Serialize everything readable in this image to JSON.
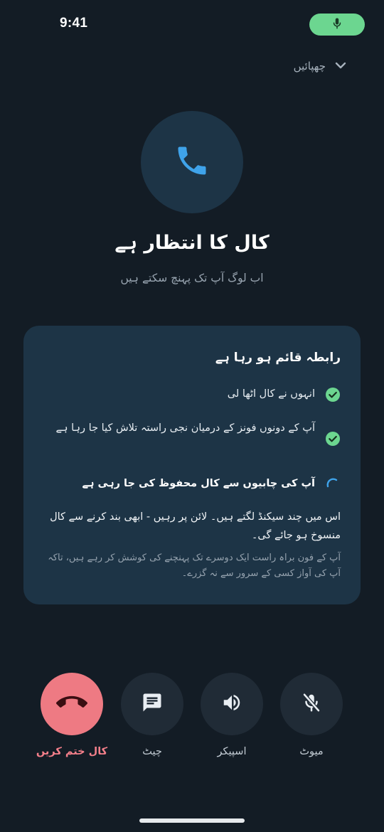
{
  "status_bar": {
    "time": "9:41",
    "mic_icon": "mic-icon"
  },
  "hide_control": {
    "label": "چھپائیں",
    "icon": "chevron-down-icon"
  },
  "call": {
    "icon": "phone-icon",
    "title": "کال کا انتظار ہے",
    "subtitle": "اب لوگ آپ تک پہنچ سکتے ہیں"
  },
  "card": {
    "title": "رابطہ قائم ہو رہا ہے",
    "steps": [
      {
        "label": "انہوں نے کال اٹھا لی",
        "status": "done"
      },
      {
        "label": "آپ کے دونوں فونز کے درمیان نجی راستہ تلاش کیا جا رہا ہے",
        "status": "done"
      },
      {
        "label": "آپ کی چابیوں سے کال محفوظ کی جا رہی ہے",
        "status": "in-progress"
      }
    ],
    "note": "اس میں چند سیکنڈ لگتے ہیں۔ لائن پر رہیں - ابھی بند کرنے سے کال منسوخ ہو جائے گی۔",
    "fine_print": "آپ کے فون براہ راست ایک دوسرے تک پہنچنے کی کوشش کر رہے ہیں، تاکہ آپ کی آواز کسی کے سرور سے نہ گزرے۔"
  },
  "controls": [
    {
      "label": "میوٹ",
      "icon": "mic-off-icon"
    },
    {
      "label": "اسپیکر",
      "icon": "speaker-icon"
    },
    {
      "label": "چیٹ",
      "icon": "chat-icon"
    },
    {
      "label": "کال ختم کریں",
      "icon": "end-call-icon"
    }
  ],
  "colors": {
    "background": "#131c25",
    "card": "#1d3446",
    "accent_blue": "#3fa3ea",
    "success_green": "#6cd690",
    "end_call": "#ee7a83"
  }
}
